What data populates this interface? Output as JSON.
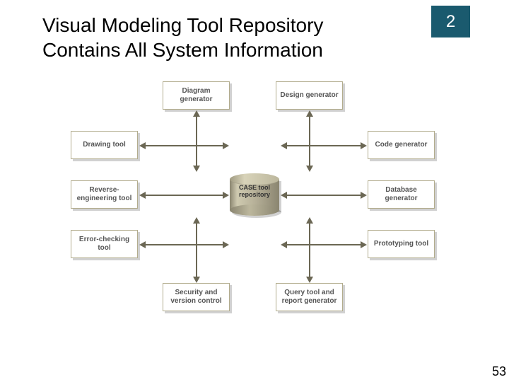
{
  "header": {
    "badge_number": "2",
    "title": "Visual Modeling Tool Repository Contains All System Information"
  },
  "diagram": {
    "center": {
      "label": "CASE tool repository"
    },
    "boxes": {
      "diagram_generator": "Diagram generator",
      "design_generator": "Design generator",
      "drawing_tool": "Drawing tool",
      "code_generator": "Code generator",
      "reverse_engineering_tool": "Reverse-engineering tool",
      "database_generator": "Database generator",
      "error_checking_tool": "Error-checking tool",
      "prototyping_tool": "Prototyping tool",
      "security_and_version_control": "Security and version control",
      "query_tool_and_report_generator": "Query tool and report generator"
    }
  },
  "footer": {
    "page_number": "53"
  }
}
